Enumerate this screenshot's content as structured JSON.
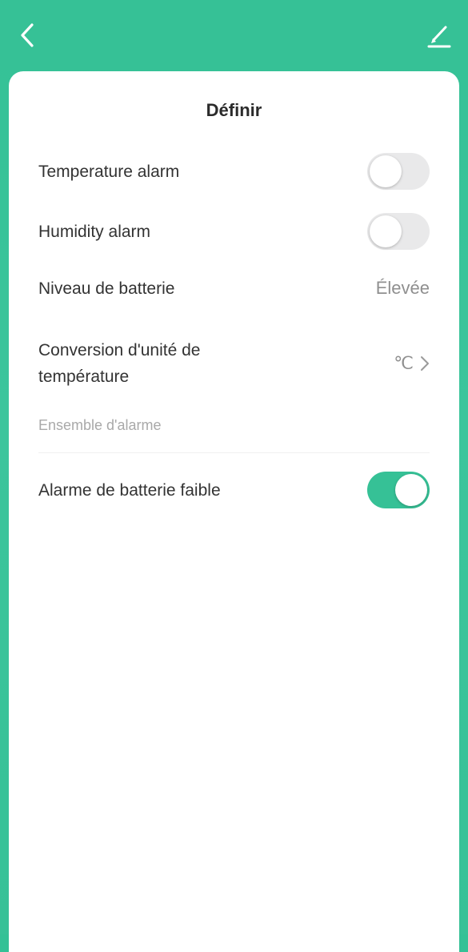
{
  "header": {
    "back_icon": "chevron-left-icon",
    "edit_icon": "pencil-icon"
  },
  "card": {
    "title": "Définir"
  },
  "settings": {
    "temperature_alarm": {
      "label": "Temperature alarm",
      "enabled": false
    },
    "humidity_alarm": {
      "label": "Humidity alarm",
      "enabled": false
    },
    "battery_level": {
      "label": "Niveau de batterie",
      "value": "Élevée"
    },
    "unit_conversion": {
      "label_line1": "Conversion d'unité de",
      "label_line2": "température",
      "value": "℃"
    },
    "alarm_section_header": "Ensemble d'alarme",
    "low_battery_alarm": {
      "label": "Alarme de batterie faible",
      "enabled": true
    }
  },
  "colors": {
    "accent": "#36c196",
    "toggle_off": "#e9e9ea",
    "text_primary": "#333333",
    "text_secondary": "#8f8f8f"
  }
}
